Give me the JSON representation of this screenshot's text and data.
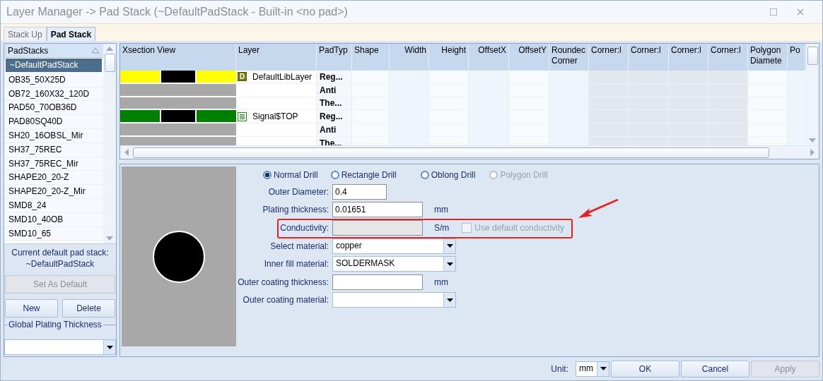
{
  "window": {
    "title": "Layer Manager -> Pad Stack (~DefaultPadStack - Built-in <no pad>)"
  },
  "tabs": [
    {
      "label": "Stack Up",
      "selected": false
    },
    {
      "label": "Pad Stack",
      "selected": true
    }
  ],
  "padstacks": {
    "header": "PadStacks",
    "items": [
      {
        "label": "~DefaultPadStack",
        "selected": true
      },
      {
        "label": "OB35_50X25D",
        "selected": false
      },
      {
        "label": "OB72_160X32_120D",
        "selected": false
      },
      {
        "label": "PAD50_70OB36D",
        "selected": false
      },
      {
        "label": "PAD80SQ40D",
        "selected": false
      },
      {
        "label": "SH20_16OBSL_Mir",
        "selected": false
      },
      {
        "label": "SH37_75REC",
        "selected": false
      },
      {
        "label": "SH37_75REC_Mir",
        "selected": false
      },
      {
        "label": "SHAPE20_20-Z",
        "selected": false
      },
      {
        "label": "SHAPE20_20-Z_Mir",
        "selected": false
      },
      {
        "label": "SMD8_24",
        "selected": false
      },
      {
        "label": "SMD10_40OB",
        "selected": false
      },
      {
        "label": "SMD10_65",
        "selected": false
      }
    ],
    "current_label": "Current default pad stack:",
    "current_value": "~DefaultPadStack",
    "buttons": [
      {
        "label": "Set As Default",
        "disabled": true
      },
      {
        "label": "New",
        "disabled": false
      },
      {
        "label": "Delete",
        "disabled": false
      }
    ],
    "plating_group": {
      "title": "Global Plating Thickness"
    }
  },
  "grid": {
    "columns": [
      {
        "label": "Xsection View",
        "kind": "xsection"
      },
      {
        "label": "Layer",
        "kind": "layer"
      },
      {
        "label": "PadTyp",
        "kind": "padtype"
      },
      {
        "label": "Shape",
        "kind": "value"
      },
      {
        "label": "Width",
        "kind": "value"
      },
      {
        "label": "Height",
        "kind": "value"
      },
      {
        "label": "OffsetX",
        "kind": "value"
      },
      {
        "label": "OffsetY",
        "kind": "value"
      },
      {
        "label": "Roundec Corner",
        "kind": "value"
      },
      {
        "label": "Corner:l",
        "kind": "locked"
      },
      {
        "label": "Corner:l",
        "kind": "locked"
      },
      {
        "label": "Corner:l",
        "kind": "locked"
      },
      {
        "label": "Corner:l",
        "kind": "locked"
      },
      {
        "label": "Polygon Diamete",
        "kind": "value"
      },
      {
        "label": "Po",
        "kind": "value"
      }
    ],
    "rows": [
      {
        "kind": "pad",
        "color": "#ffff00",
        "layer": "DefaultLibLayer",
        "layer_icon": {
          "kind": "letter",
          "text": "D"
        },
        "padtype": "Reg..."
      },
      {
        "kind": "blank",
        "padtype": "Anti"
      },
      {
        "kind": "blank",
        "padtype": "The..."
      },
      {
        "kind": "pad",
        "color": "#008000",
        "layer": "Signal$TOP",
        "layer_icon": {
          "kind": "lines"
        },
        "padtype": "Reg..."
      },
      {
        "kind": "blank",
        "padtype": "Anti"
      },
      {
        "kind": "blank",
        "padtype": "The..."
      }
    ]
  },
  "drill": {
    "options": [
      {
        "label": "Normal Drill",
        "selected": true,
        "disabled": false
      },
      {
        "label": "Rectangle Drill",
        "selected": false,
        "disabled": false
      },
      {
        "label": "Oblong Drill",
        "selected": false,
        "disabled": false
      },
      {
        "label": "Polygon Drill",
        "selected": false,
        "disabled": true
      }
    ],
    "fields": [
      {
        "kind": "short",
        "label": "Outer Diameter:",
        "value": "0.4"
      },
      {
        "kind": "text",
        "label": "Plating thickness:",
        "value": "0.01651",
        "unit": "mm"
      },
      {
        "kind": "text",
        "label": "Conductivity:",
        "unit": "S/m",
        "disabled": true,
        "highlighted": true,
        "checkbox": {
          "label": "Use default conductivity",
          "checked": false,
          "disabled": true
        }
      },
      {
        "kind": "combo",
        "label": "Select material:",
        "value": "copper"
      },
      {
        "kind": "combo",
        "label": "Inner fill material:",
        "value": "SOLDERMASK"
      },
      {
        "kind": "text",
        "label": "Outer coating thickness:",
        "unit": "mm"
      },
      {
        "kind": "combo",
        "label": "Outer coating material:"
      }
    ]
  },
  "footer": {
    "unit_label": "Unit:",
    "unit_value": "mm",
    "buttons": [
      {
        "label": "OK",
        "disabled": false
      },
      {
        "label": "Cancel",
        "disabled": false
      },
      {
        "label": "Apply",
        "disabled": true
      }
    ]
  }
}
